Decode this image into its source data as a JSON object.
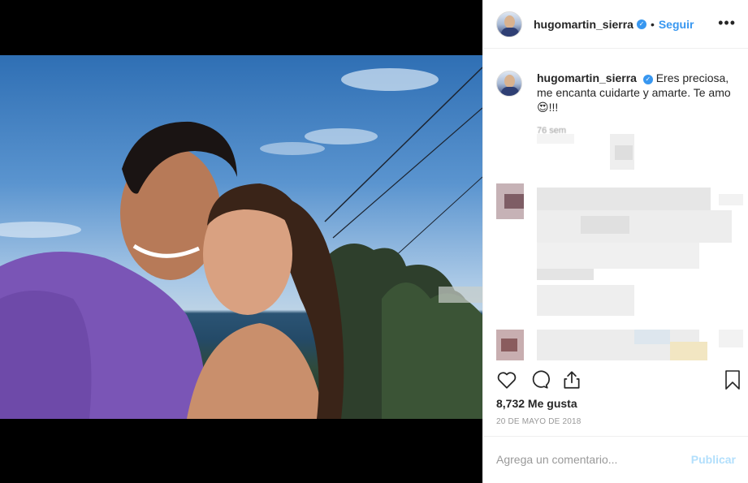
{
  "post": {
    "username": "hugomartin_sierra",
    "follow_label": "Seguir",
    "separator": "•",
    "more_label": "•••",
    "caption_text": "Eres preciosa, me encanta cuidarte y amarte. Te amo 😍!!!",
    "caption_time": "76 sem",
    "likes": "8,732 Me gusta",
    "date": "20 DE MAYO DE 2018",
    "comment_placeholder": "Agrega un comentario...",
    "publish_label": "Publicar",
    "verified_mark": "✓"
  },
  "colors": {
    "accent": "#3897f0",
    "publish_disabled": "#b2dffc",
    "text": "#262626",
    "muted": "#999999",
    "border": "#efefef"
  },
  "icons": [
    "heart-icon",
    "comment-icon",
    "share-icon",
    "bookmark-icon",
    "more-icon",
    "verified-badge-icon"
  ]
}
